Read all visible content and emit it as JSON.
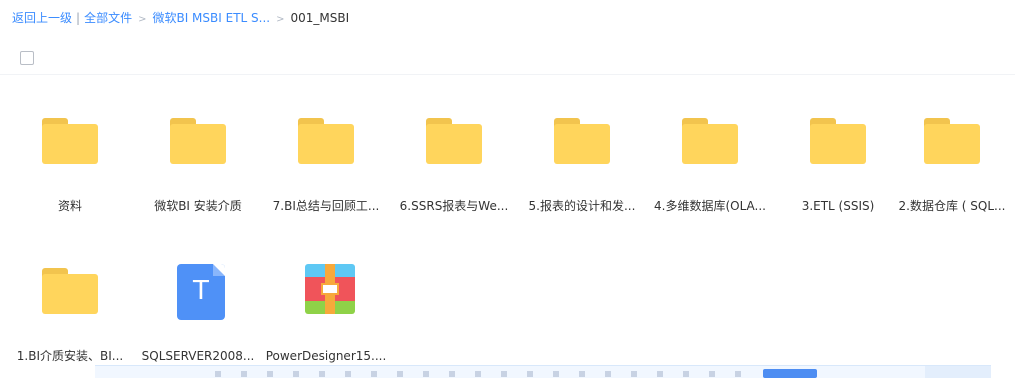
{
  "breadcrumb": {
    "back_label": "返回上一级",
    "all_files_label": "全部文件",
    "folder_label": "微软BI MSBI ETL S...",
    "current_label": "001_MSBI"
  },
  "files": [
    {
      "name": "资料",
      "type": "folder"
    },
    {
      "name": "微软BI 安装介质",
      "type": "folder"
    },
    {
      "name": "7.BI总结与回顾工...",
      "type": "folder"
    },
    {
      "name": "6.SSRS报表与We...",
      "type": "folder"
    },
    {
      "name": "5.报表的设计和发...",
      "type": "folder"
    },
    {
      "name": "4.多维数据库(OLA...",
      "type": "folder"
    },
    {
      "name": "3.ETL (SSIS)",
      "type": "folder"
    },
    {
      "name": "2.数据仓库 ( SQL...",
      "type": "folder"
    },
    {
      "name": "1.BI介质安装、BI...",
      "type": "folder"
    },
    {
      "name": "SQLSERVER2008...",
      "type": "document",
      "glyph": "T"
    },
    {
      "name": "PowerDesigner15....",
      "type": "archive"
    }
  ],
  "colors": {
    "accent": "#3b8cff",
    "folder": "#ffd55c",
    "document": "#4f91f7"
  }
}
